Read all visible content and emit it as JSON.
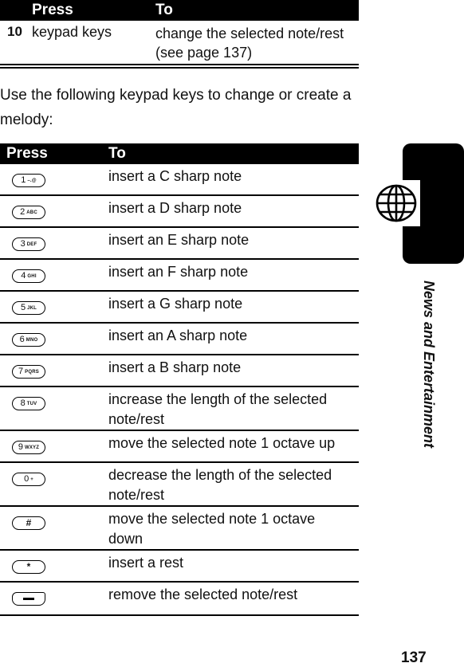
{
  "top_table": {
    "header": {
      "press": "Press",
      "to": "To"
    },
    "row": {
      "number": "10",
      "press": "keypad keys",
      "to": "change the selected note/rest (see page 137)"
    }
  },
  "intro_text": "Use the following keypad keys to change or create a melody:",
  "main_table": {
    "header": {
      "press": "Press",
      "to": "To"
    },
    "rows": [
      {
        "key_digit": "1",
        "key_letters": "–.@",
        "key_type": "digit",
        "to": "insert a C sharp note"
      },
      {
        "key_digit": "2",
        "key_letters": "ABC",
        "key_type": "digit",
        "to": "insert a D sharp note"
      },
      {
        "key_digit": "3",
        "key_letters": "DEF",
        "key_type": "digit",
        "to": "insert an E sharp note"
      },
      {
        "key_digit": "4",
        "key_letters": "GHI",
        "key_type": "digit",
        "to": "insert an F sharp note"
      },
      {
        "key_digit": "5",
        "key_letters": "JKL",
        "key_type": "digit",
        "to": "insert a G sharp note"
      },
      {
        "key_digit": "6",
        "key_letters": "MNO",
        "key_type": "digit",
        "to": "insert an A sharp note"
      },
      {
        "key_digit": "7",
        "key_letters": "PQRS",
        "key_type": "digit",
        "to": "insert a B sharp note"
      },
      {
        "key_digit": "8",
        "key_letters": "TUV",
        "key_type": "digit",
        "to": "increase the length of the selected note/rest"
      },
      {
        "key_digit": "9",
        "key_letters": "WXYZ",
        "key_type": "digit",
        "to": "move the selected note 1 octave up"
      },
      {
        "key_digit": "0",
        "key_letters": "+",
        "key_type": "digit",
        "to": "decrease the length of the selected note/rest"
      },
      {
        "key_digit": "#",
        "key_letters": "",
        "key_type": "symbol",
        "to": "move the selected note 1 octave down"
      },
      {
        "key_digit": "*",
        "key_letters": "",
        "key_type": "symbol",
        "to": "insert a rest"
      },
      {
        "key_digit": "",
        "key_letters": "",
        "key_type": "soft-minus",
        "to": "remove the selected note/rest"
      }
    ]
  },
  "side_tab": {
    "icon": "globe-icon",
    "title": "News and Entertainment"
  },
  "page_number": "137"
}
